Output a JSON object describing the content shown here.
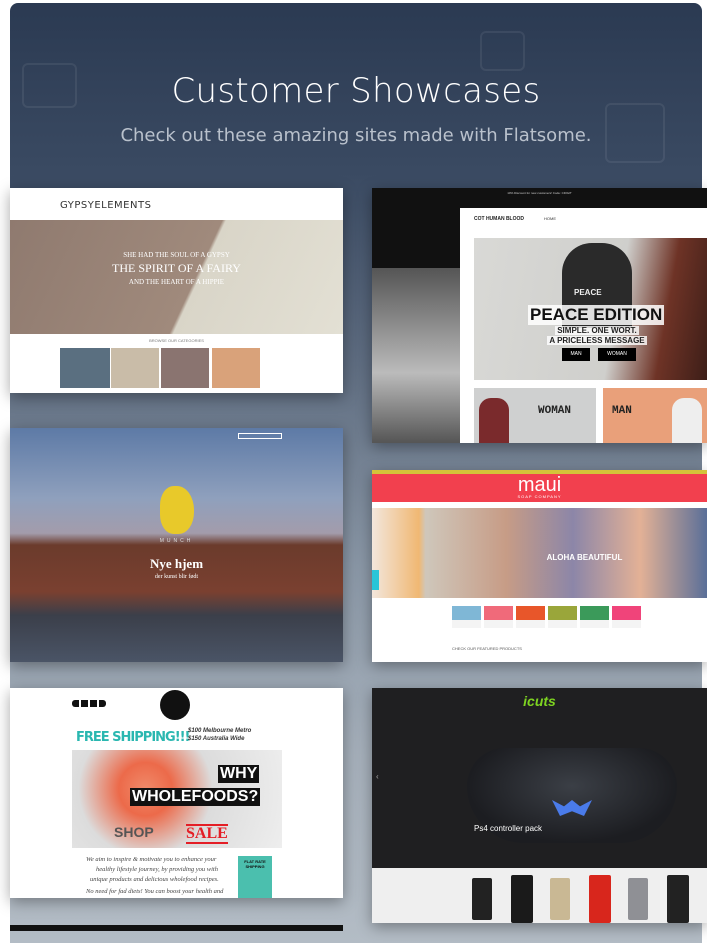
{
  "header": {
    "title": "Customer Showcases",
    "subtitle": "Check out these amazing sites made with Flatsome."
  },
  "showcases": [
    {
      "name": "gypsyelements",
      "logo": "GYPSYELEMENTS",
      "hero_line1": "SHE HAD THE SOUL OF A GYPSY",
      "hero_line2": "THE SPIRIT OF A FAIRY",
      "hero_line3": "AND THE HEART OF A HIPPIE",
      "section": "BROWSE OUR CATEGORIES"
    },
    {
      "name": "cotton-human-blood",
      "topbar": "10% Discount for new customers! Code: CDIGIT",
      "logo": "COT HUMAN BLOOD",
      "nav": "HOME",
      "hero_title": "PEACE EDITION",
      "hero_sub1": "SIMPLE. ONE WORT.",
      "hero_sub2": "A PRICELESS MESSAGE",
      "btn_man": "MAN",
      "btn_woman": "WOMAN",
      "tile_woman": "WOMAN",
      "tile_man": "MAN",
      "shirt": "PEACE"
    },
    {
      "name": "munch-brygge",
      "brand": "MUNCH",
      "hero_title": "Nye hjem",
      "hero_sub": "der kunst blir født"
    },
    {
      "name": "maui-soap",
      "logo": "maui",
      "logo_sub": "SOAP COMPANY",
      "hero": "ALOHA BEAUTIFUL",
      "section": "CHECK OUR FEATURED PRODUCTS",
      "tile_colors": [
        "#7fb7d6",
        "#f06a7a",
        "#e8562a",
        "#9aa63a",
        "#3b9a5a",
        "#f0447a"
      ]
    },
    {
      "name": "wholefoods",
      "free_shipping": "FREE SHIPPING!!!",
      "shipping_note1": "$100 Melbourne Metro",
      "shipping_note2": "$150 Australia Wide",
      "why": "WHY",
      "wholefoods": "WHOLEFOODS?",
      "shop": "SHOP",
      "sale": "SALE",
      "body1": "We aim to inspire & motivate you to enhance your",
      "body2": "healthy lifestyle journey, by providing you with",
      "body3": "unique products and delicious wholefood recipes.",
      "body4": "No need for fad diets! You can boost your health and",
      "badge": "FLAT RATE SHIPPING"
    },
    {
      "name": "icuts",
      "logo": "icuts",
      "product": "Ps4 controller pack",
      "phone_colors": [
        "#222",
        "#1a1a1a",
        "#c9b894",
        "#d8261c",
        "#8f9095",
        "#222"
      ]
    }
  ],
  "colors": {
    "panel_top": "#2b3a52",
    "maui_red": "#f2404e",
    "icuts_green": "#7dd321",
    "wf_teal": "#2ab7b0",
    "sale_red": "#e41e26"
  }
}
